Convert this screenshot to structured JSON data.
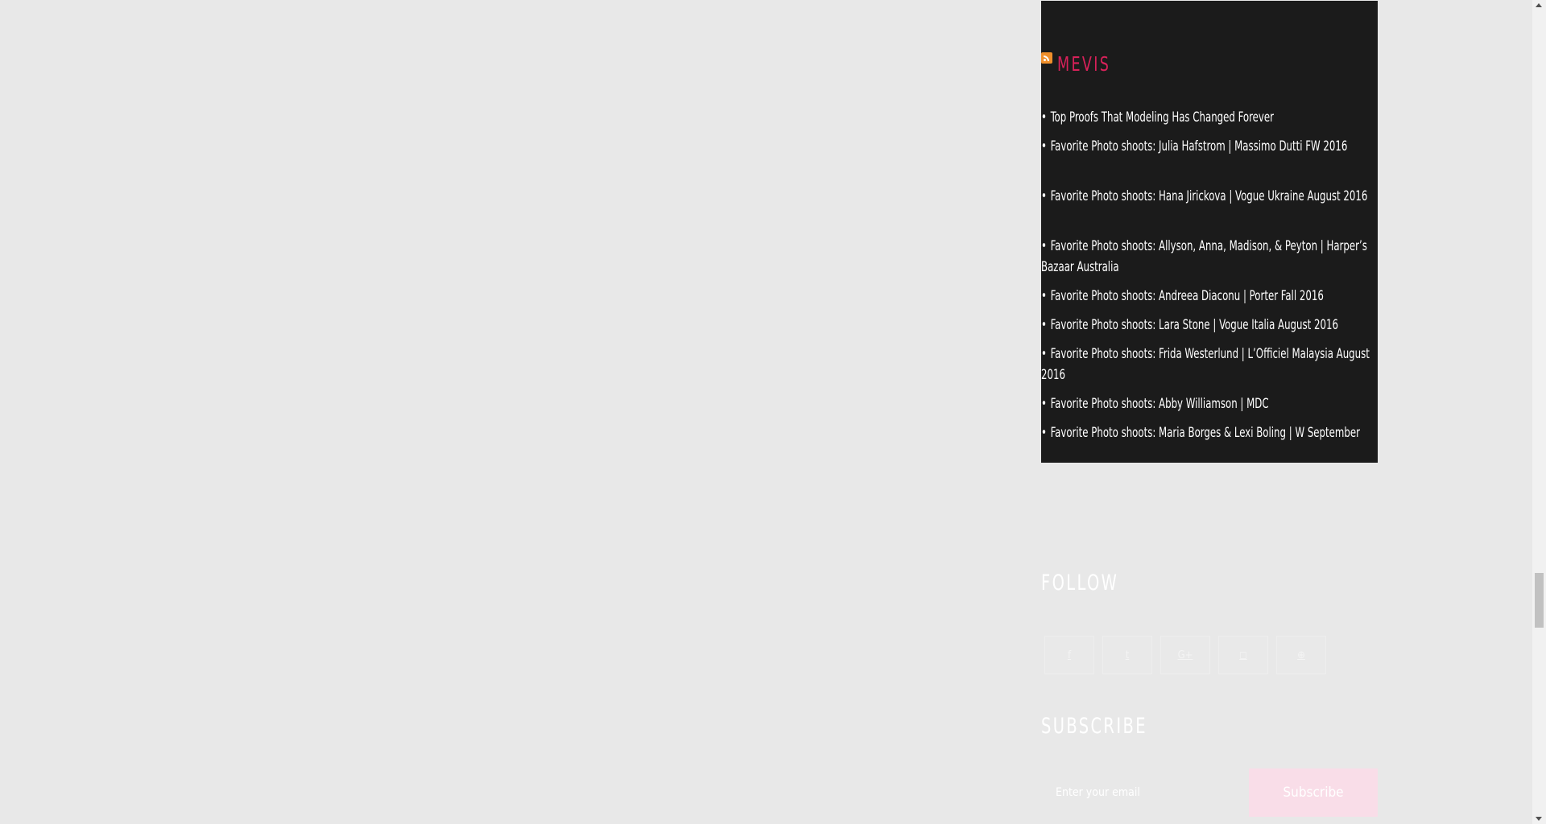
{
  "rss": {
    "title": "MEVIS",
    "icon": "rss-feed-icon",
    "items": [
      "Top Proofs That Modeling Has Changed Forever",
      "Favorite Photo shoots: Julia Hafstrom | Massimo Dutti FW 2016",
      "Favorite Photo shoots: Hana Jirickova | Vogue Ukraine August 2016",
      "Favorite Photo shoots: Allyson, Anna, Madison, & Peyton | Harper’s Bazaar Australia",
      "Favorite Photo shoots: Andreea Diaconu | Porter Fall 2016",
      "Favorite Photo shoots: Lara Stone | Vogue Italia August 2016",
      "Favorite Photo shoots: Frida Westerlund | L’Officiel Malaysia August 2016",
      "Favorite Photo shoots: Abby Williamson | MDC",
      "Favorite Photo shoots: Maria Borges & Lexi Boling | W September"
    ]
  },
  "follow": {
    "title": "FOLLOW",
    "icons": [
      "facebook-icon",
      "twitter-icon",
      "google-plus-icon",
      "instagram-icon",
      "pinterest-icon"
    ],
    "glyphs": [
      "f",
      "t",
      "G+",
      "◻",
      "⊕"
    ]
  },
  "subscribe": {
    "title": "SUBSCRIBE",
    "placeholder": "Enter your email",
    "button": "Subscribe"
  },
  "colors": {
    "accent": "#d8215a",
    "widget_bg": "#1b1b1b",
    "page_bg": "#e8e8e8",
    "subscribe_button_bg": "#f9dde8"
  }
}
